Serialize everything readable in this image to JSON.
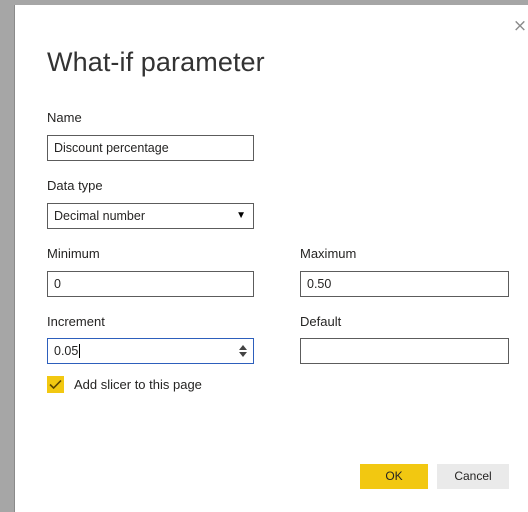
{
  "dialog": {
    "title": "What-if parameter",
    "close_glyph": "×"
  },
  "name": {
    "label": "Name",
    "value": "Discount percentage"
  },
  "data_type": {
    "label": "Data type",
    "selected": "Decimal number",
    "arrow_glyph": "▼"
  },
  "minimum": {
    "label": "Minimum",
    "value": "0"
  },
  "maximum": {
    "label": "Maximum",
    "value": "0.50"
  },
  "increment": {
    "label": "Increment",
    "value": "0.05"
  },
  "default": {
    "label": "Default",
    "value": ""
  },
  "slicer": {
    "label": "Add slicer to this page",
    "checked": true
  },
  "buttons": {
    "ok": "OK",
    "cancel": "Cancel"
  },
  "colors": {
    "accent": "#f2c811",
    "focus_border": "#2d5fbc",
    "frame": "#a6a6a6"
  }
}
